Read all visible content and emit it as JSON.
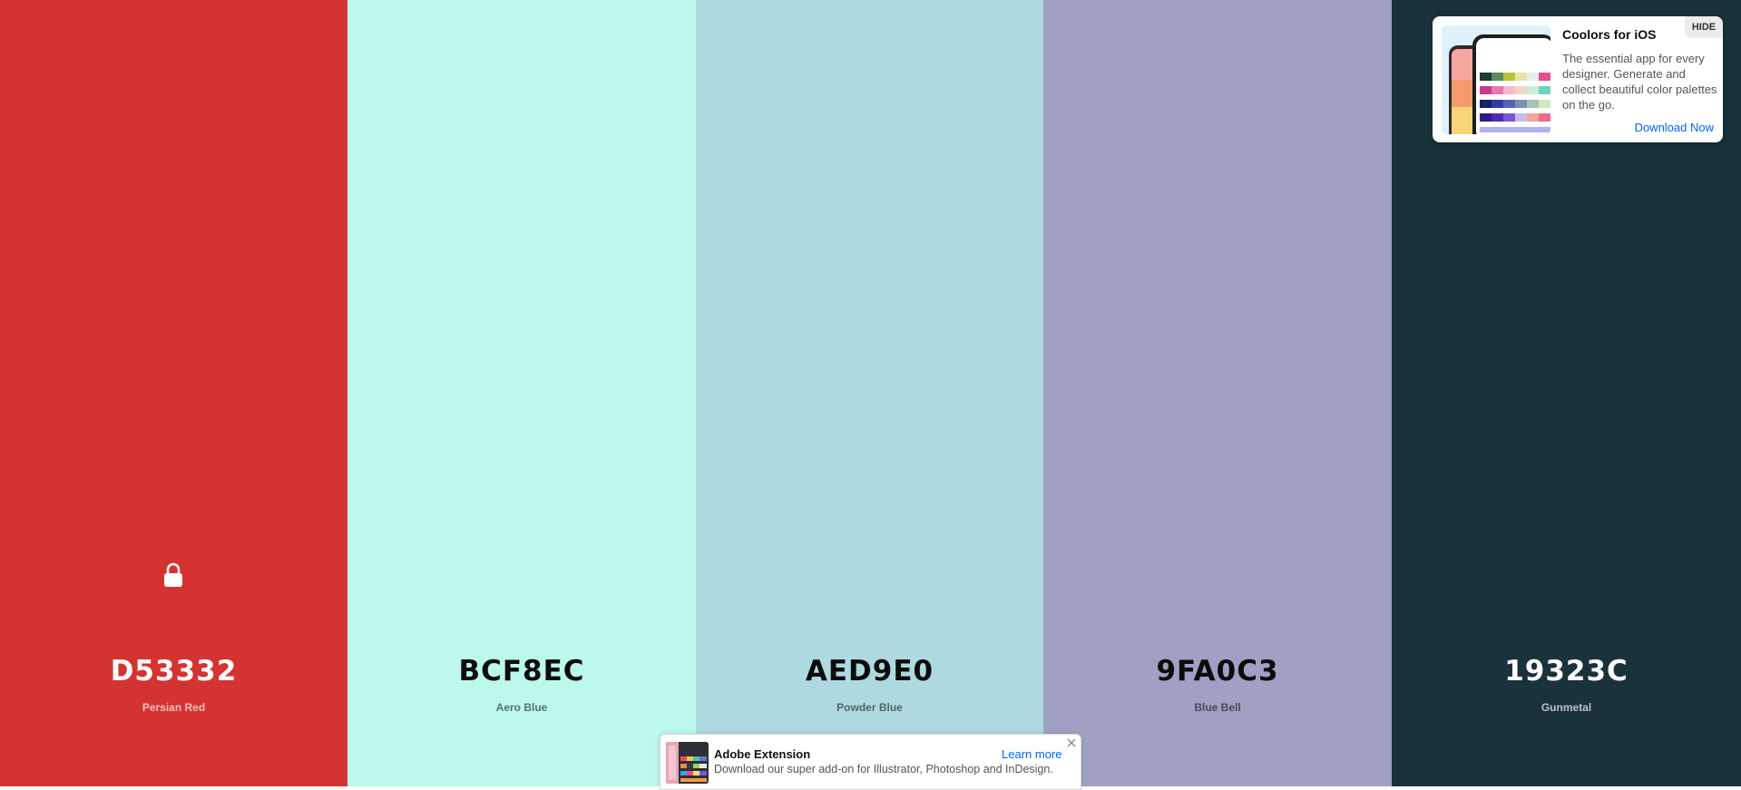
{
  "palette": {
    "colors": [
      {
        "hex": "D53332",
        "name": "Persian Red",
        "bg": "#D53332",
        "locked": true
      },
      {
        "hex": "BCF8EC",
        "name": "Aero Blue",
        "bg": "#BCF8EC",
        "locked": false
      },
      {
        "hex": "AED9E0",
        "name": "Powder Blue",
        "bg": "#AED9E0",
        "locked": false
      },
      {
        "hex": "9FA0C3",
        "name": "Blue Bell",
        "bg": "#9FA0C3",
        "locked": false
      },
      {
        "hex": "19323C",
        "name": "Gunmetal",
        "bg": "#19323C",
        "locked": false
      }
    ],
    "lock_icon": "lock-icon"
  },
  "promo": {
    "title": "Coolors for iOS",
    "description": "The essential app for every designer. Generate and collect beautiful color palettes on the go.",
    "cta": "Download Now",
    "hide_label": "HIDE",
    "thumbnail_icon": "phone-app-preview"
  },
  "banner": {
    "title": "Adobe Extension",
    "description": "Download our super add-on for Illustrator, Photoshop and InDesign.",
    "link": "Learn more",
    "close_icon": "close-icon",
    "thumbnail_icon": "extension-preview"
  },
  "accent_color": "#0066FF"
}
